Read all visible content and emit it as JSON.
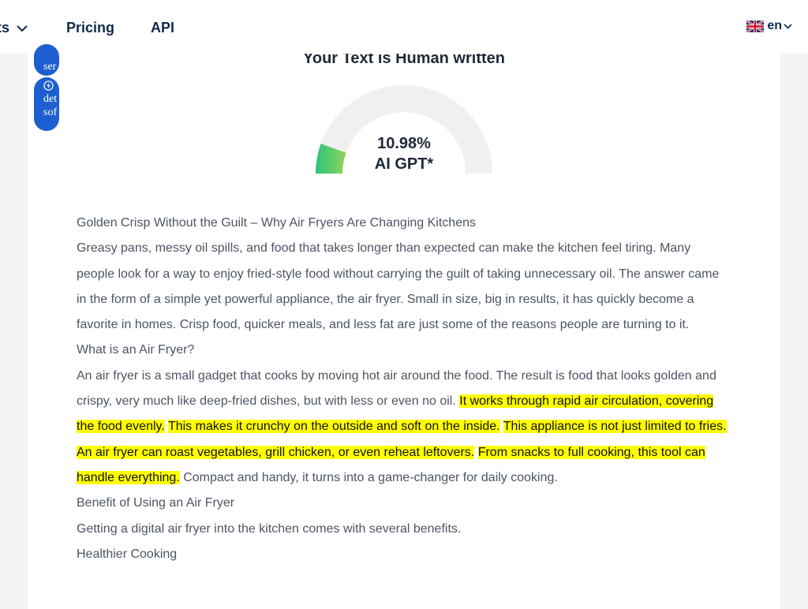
{
  "nav": {
    "products_label": "ts",
    "pricing_label": "Pricing",
    "api_label": "API",
    "lang_label": "en",
    "flag_icon": "uk-flag-icon",
    "chevron_icon": "chevron-down-icon"
  },
  "sidebar": {
    "pill1_text": "ser",
    "pill2_lines": [
      "det",
      "sof"
    ],
    "pill2_icon": "bolt-icon"
  },
  "result": {
    "title": "Your Text is Human written",
    "gauge_percent_label": "10.98%",
    "gauge_caption": "AI GPT*",
    "gauge_fraction": 0.1098,
    "gauge_colors": {
      "track": "#f0f0f0",
      "fill_start": "#2ec27e",
      "fill_end": "#8fd45a"
    }
  },
  "article": {
    "title": "Golden Crisp Without the Guilt – Why Air Fryers Are Changing Kitchens",
    "intro": "Greasy pans, messy oil spills, and food that takes longer than expected can make the kitchen feel tiring. Many people look for a way to enjoy fried-style food without carrying the guilt of taking unnecessary oil. The answer came in the form of a simple yet powerful appliance, the air fryer. Small in size, big in results, it has quickly become a favorite in homes. Crisp food, quicker meals, and less fat are just some of the reasons people are turning to it.",
    "heading_what": "What is an Air Fryer?",
    "what_body_1": "An air fryer is a small gadget that cooks by moving hot air around the food. The result is food that looks golden and crispy, very much like deep-fried dishes, but with less or even no oil. ",
    "what_hl_1": "It works through rapid air circulation, covering the food evenly.",
    "what_hl_2": "This makes it crunchy on the outside and soft on the inside.",
    "what_hl_3": "This appliance is not just limited to fries.",
    "what_hl_4": "An air fryer can roast vegetables, grill chicken, or even reheat leftovers.",
    "what_hl_5": "From snacks to full cooking, this tool can handle everything.",
    "what_body_2": " Compact and handy, it turns into a game-changer for daily cooking.",
    "heading_benefit": "Benefit of Using an Air Fryer",
    "benefit_body": "Getting a digital air fryer into the kitchen comes with several benefits.",
    "heading_healthier": "Healthier Cooking",
    "highlight_color": "#ffff00"
  }
}
